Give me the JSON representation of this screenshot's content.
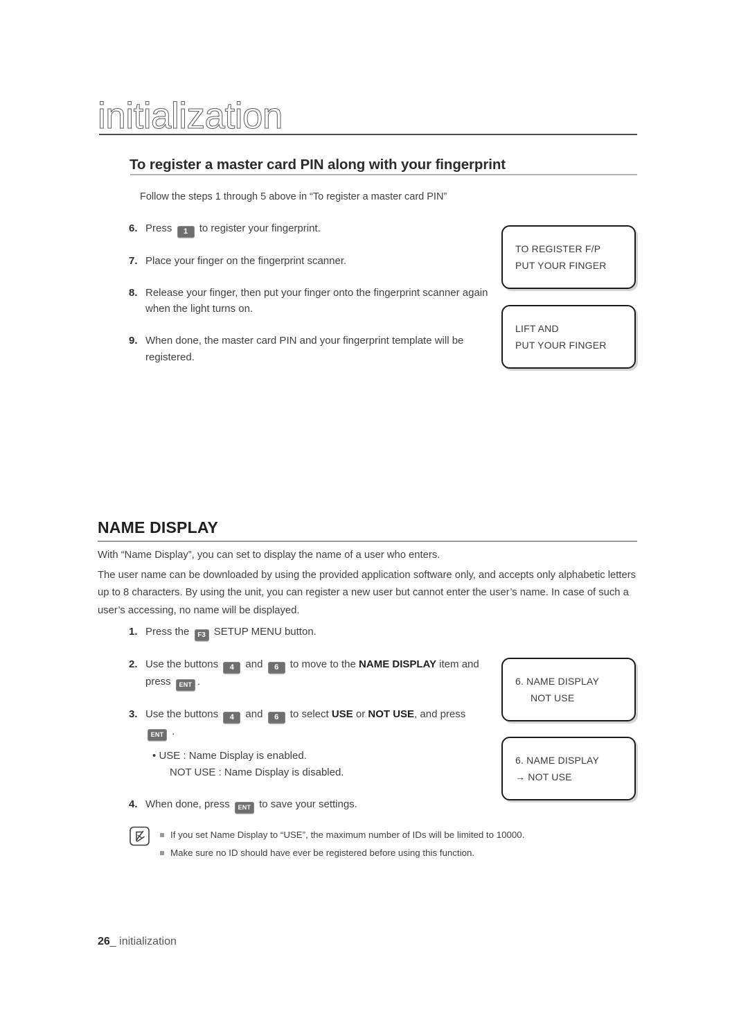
{
  "chapter": {
    "title": "initialization"
  },
  "section_a": {
    "heading": "To register a master card PIN along with your fingerprint",
    "intro": "Follow the steps 1 through 5 above in “To register a master card PIN”",
    "steps": [
      {
        "num": "6.",
        "before": "Press",
        "key": "1",
        "key_type": "num",
        "after": "to register your fingerprint."
      },
      {
        "num": "7.",
        "before": "Place your finger on the fingerprint scanner.",
        "key": "",
        "key_type": "",
        "after": ""
      },
      {
        "num": "8.",
        "before": "Release your finger, then put your finger onto the fingerprint scanner again when the light turns on.",
        "key": "",
        "key_type": "",
        "after": ""
      },
      {
        "num": "9.",
        "before": "When done, the master card PIN and your fingerprint template will be registered.",
        "key": "",
        "key_type": "",
        "after": ""
      }
    ],
    "lcd_1": {
      "line1": "TO REGISTER F/P",
      "line2": "PUT YOUR FINGER"
    },
    "lcd_2": {
      "line1": "LIFT AND",
      "line2": "PUT YOUR FINGER"
    }
  },
  "section_b": {
    "heading": "NAME DISPLAY",
    "para_1": "With “Name Display”, you can set to display the name of a user who enters.",
    "para_2": "The user name can be downloaded by using the provided application software only, and accepts only alphabetic letters up to 8 characters. By using the unit, you can register a new user but cannot enter the user’s name. In case of such a user’s accessing, no name will be displayed.",
    "step_1": {
      "num": "1.",
      "t1": "Press the",
      "key1": "F3",
      "t2": "SETUP MENU button."
    },
    "step_2": {
      "num": "2.",
      "t1": "Use the buttons",
      "key1": "4",
      "t2": "and",
      "key2": "6",
      "t3": "to move to the",
      "bold": "NAME DISPLAY",
      "t4": "item and press",
      "key3": "ENT",
      "t5": "."
    },
    "step_3": {
      "num": "3.",
      "t1": "Use the buttons",
      "key1": "4",
      "t2": "and",
      "key2": "6",
      "t3": "to select",
      "bold1": "USE",
      "t4": "or",
      "bold2": "NOT USE",
      "t5": ", and press",
      "key3": "ENT",
      "t6": "."
    },
    "bullet_1": "USE : Name Display is enabled.",
    "bullet_2": "NOT USE : Name Display is disabled.",
    "step_4": {
      "num": "4.",
      "t1": "When done, press",
      "key1": "ENT",
      "t2": "to save your settings."
    },
    "lcd_3": {
      "line1": "6. NAME DISPLAY",
      "line2": "NOT USE"
    },
    "lcd_4": {
      "line1": "6. NAME DISPLAY",
      "line2": "→ NOT USE"
    }
  },
  "note": {
    "item_1": "If you set Name Display to “USE”, the maximum number of IDs will be limited to 10000.",
    "item_2": "Make sure no ID should have ever be registered before using this function."
  },
  "footer": {
    "page": "26",
    "sep": "_",
    "label": "initialization"
  }
}
